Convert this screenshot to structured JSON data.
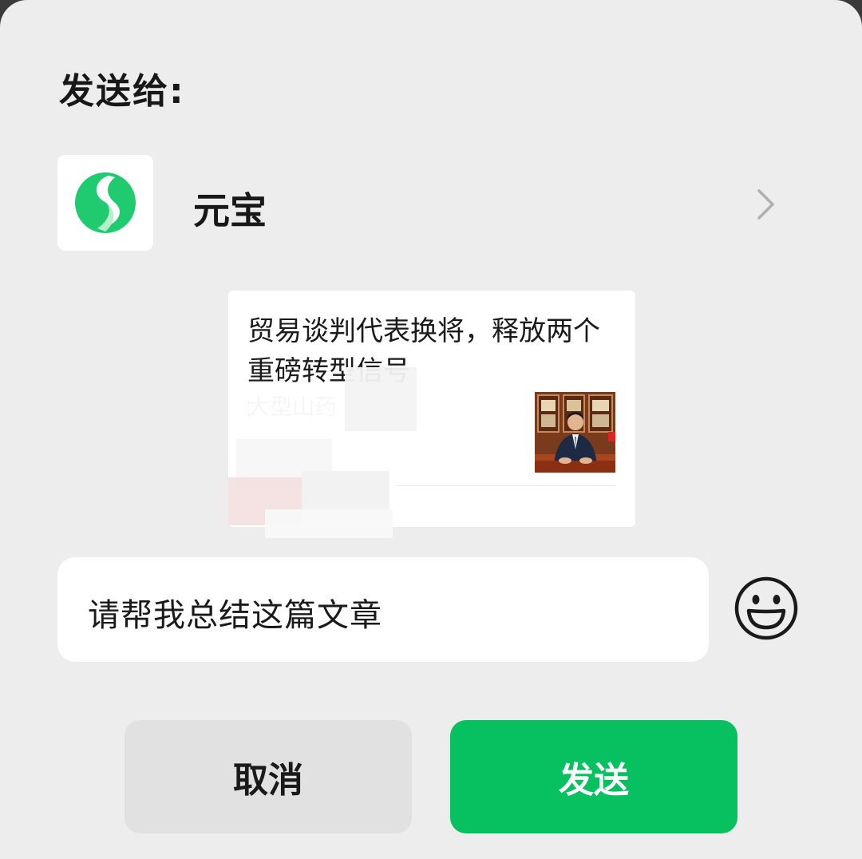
{
  "dialog": {
    "send_to_label": "发送给:"
  },
  "recipient": {
    "name": "元宝",
    "avatar_icon": "yuanbao-logo-icon",
    "brand_color": "#1fcb6e"
  },
  "article": {
    "title": "贸易谈判代表换将，释放两个重磅转型信号",
    "description_visible": "大型山药",
    "thumbnail_icon": "person-photo-thumbnail"
  },
  "message": {
    "value": "请帮我总结这篇文章"
  },
  "buttons": {
    "cancel_label": "取消",
    "send_label": "发送",
    "send_color": "#07c160"
  },
  "icons": {
    "chevron": "chevron-right-icon",
    "emoji": "smiley-emoji-icon"
  }
}
